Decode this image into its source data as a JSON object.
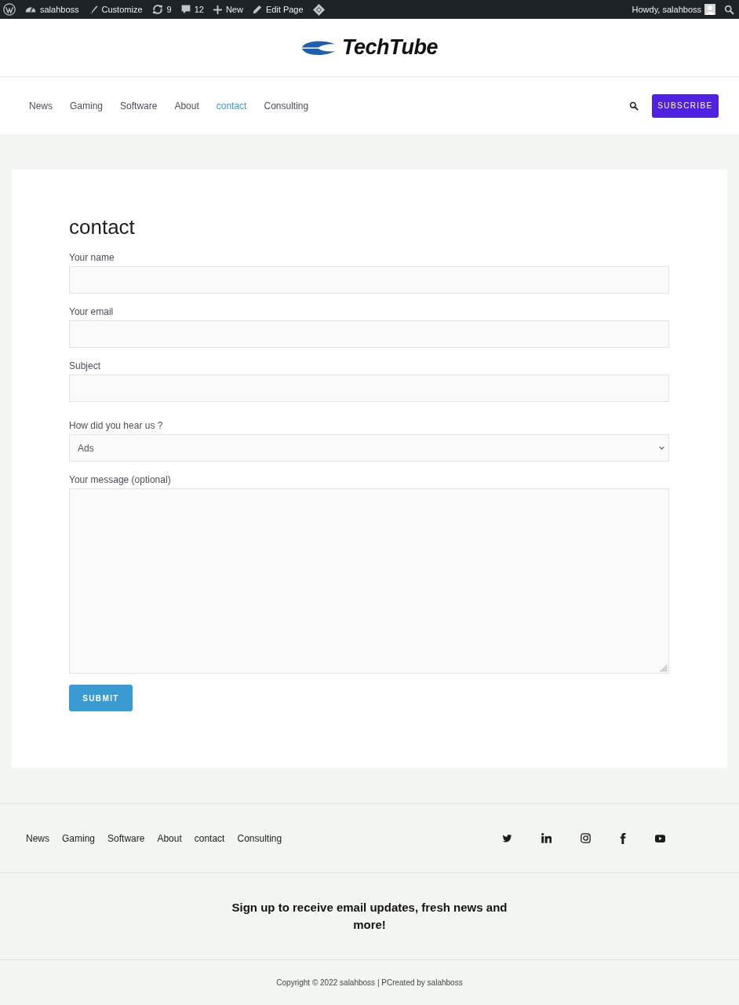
{
  "admin_bar": {
    "site": "salahboss",
    "customize": "Customize",
    "updates": "9",
    "comments": "12",
    "new": "New",
    "edit": "Edit Page",
    "greeting": "Howdy, salahboss"
  },
  "header": {
    "logo": "TechTube"
  },
  "nav": {
    "items": [
      {
        "label": "News",
        "selected": false
      },
      {
        "label": "Gaming",
        "selected": false
      },
      {
        "label": "Software",
        "selected": false
      },
      {
        "label": "About",
        "selected": false
      },
      {
        "label": "contact",
        "selected": true
      },
      {
        "label": "Consulting",
        "selected": false
      }
    ],
    "subscribe_button": "SUBSCRIBE"
  },
  "form": {
    "title": "contact",
    "fields": [
      {
        "kind": "text",
        "label": "Your name"
      },
      {
        "kind": "text",
        "label": "Your email"
      },
      {
        "kind": "text",
        "label": "Subject"
      },
      {
        "kind": "select",
        "label": "How did you hear us ?",
        "value": "Ads"
      },
      {
        "kind": "textarea",
        "label": "Your message (optional)"
      }
    ],
    "submit_button": "SUBMIT"
  },
  "footer": {
    "menu": [
      "News",
      "Gaming",
      "Software",
      "About",
      "contact",
      "Consulting"
    ],
    "signup_text": "Sign up to receive email updates, fresh news and more!",
    "copyright": "Copyright © 2022 salahboss | PCreated by salahboss"
  }
}
